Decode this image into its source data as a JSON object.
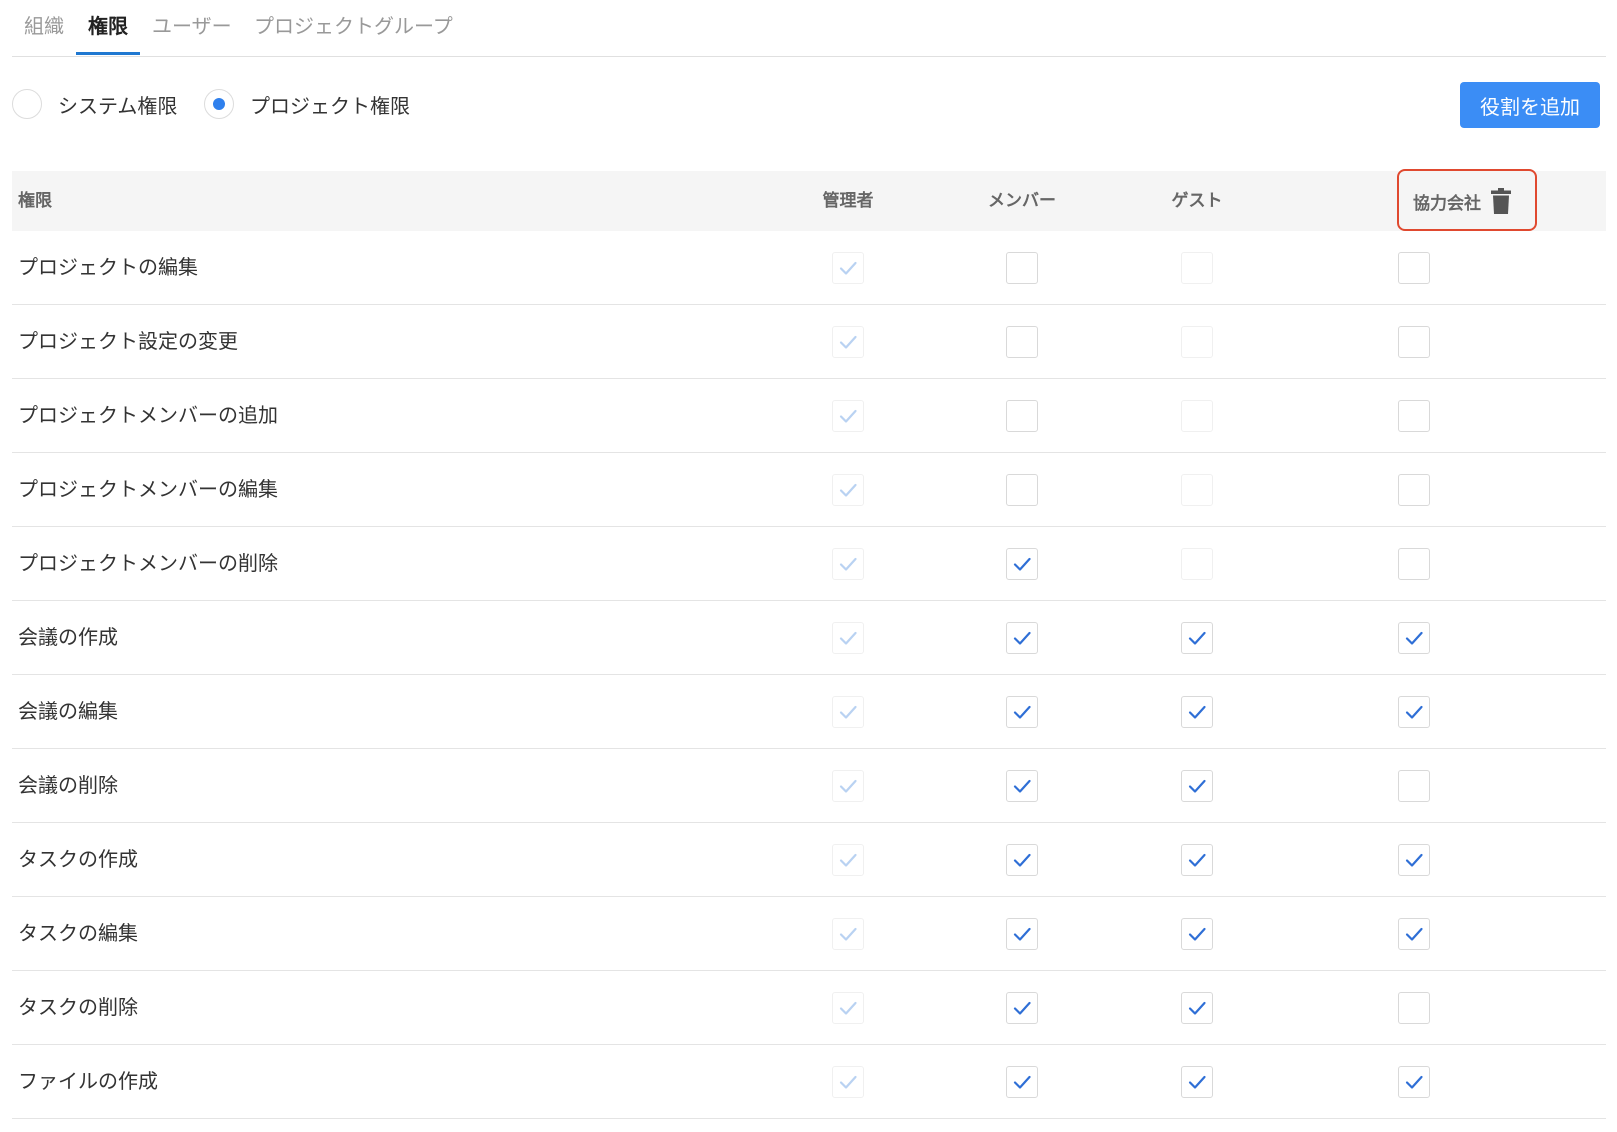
{
  "tabs": [
    {
      "label": "組織",
      "active": false
    },
    {
      "label": "権限",
      "active": true
    },
    {
      "label": "ユーザー",
      "active": false
    },
    {
      "label": "プロジェクトグループ",
      "active": false
    }
  ],
  "scope": {
    "options": [
      {
        "label": "システム権限",
        "selected": false
      },
      {
        "label": "プロジェクト権限",
        "selected": true
      }
    ]
  },
  "toolbar": {
    "add_role_label": "役割を追加"
  },
  "table": {
    "columns": {
      "permission": "権限",
      "admin": "管理者",
      "member": "メンバー",
      "guest": "ゲスト",
      "partner": "協力会社"
    },
    "rows": [
      {
        "label": "プロジェクトの編集",
        "admin": true,
        "member": false,
        "guest": false,
        "partner": false
      },
      {
        "label": "プロジェクト設定の変更",
        "admin": true,
        "member": false,
        "guest": false,
        "partner": false
      },
      {
        "label": "プロジェクトメンバーの追加",
        "admin": true,
        "member": false,
        "guest": false,
        "partner": false
      },
      {
        "label": "プロジェクトメンバーの編集",
        "admin": true,
        "member": false,
        "guest": false,
        "partner": false
      },
      {
        "label": "プロジェクトメンバーの削除",
        "admin": true,
        "member": true,
        "guest": false,
        "partner": false
      },
      {
        "label": "会議の作成",
        "admin": true,
        "member": true,
        "guest": true,
        "partner": true
      },
      {
        "label": "会議の編集",
        "admin": true,
        "member": true,
        "guest": true,
        "partner": true
      },
      {
        "label": "会議の削除",
        "admin": true,
        "member": true,
        "guest": true,
        "partner": false
      },
      {
        "label": "タスクの作成",
        "admin": true,
        "member": true,
        "guest": true,
        "partner": true
      },
      {
        "label": "タスクの編集",
        "admin": true,
        "member": true,
        "guest": true,
        "partner": true
      },
      {
        "label": "タスクの削除",
        "admin": true,
        "member": true,
        "guest": true,
        "partner": false
      },
      {
        "label": "ファイルの作成",
        "admin": true,
        "member": true,
        "guest": true,
        "partner": true
      }
    ]
  },
  "colors": {
    "accent": "#3b8df5",
    "check": "#2f6fd6",
    "check_disabled": "#b9d2f2",
    "highlight": "#e0492f"
  }
}
